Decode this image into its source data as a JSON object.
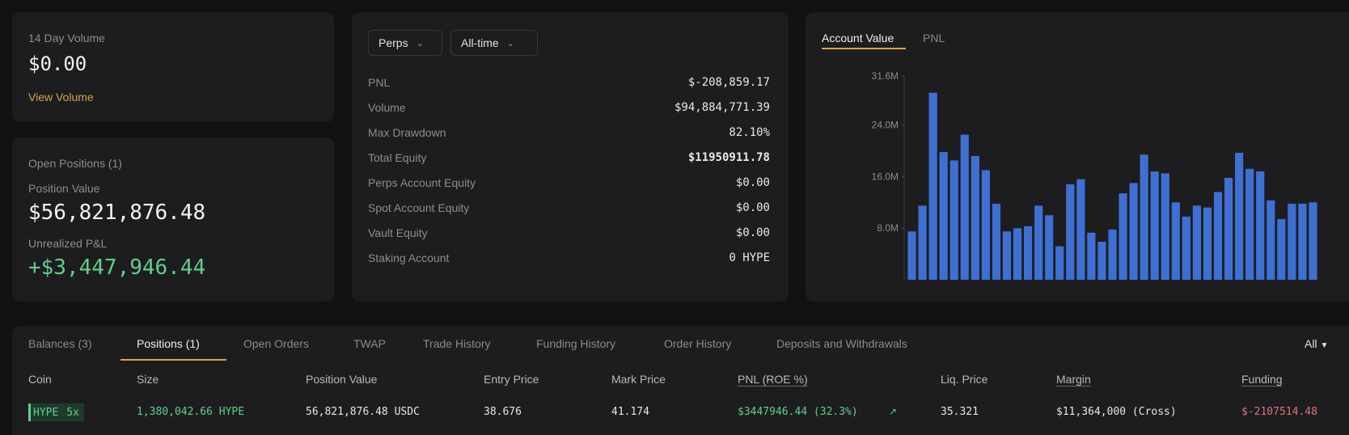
{
  "volume": {
    "label": "14 Day Volume",
    "value": "$0.00",
    "link": "View Volume"
  },
  "positions_summary": {
    "title": "Open Positions (1)",
    "value_label": "Position Value",
    "value": "$56,821,876.48",
    "upnl_label": "Unrealized P&L",
    "upnl": "+$3,447,946.44"
  },
  "stats": {
    "filter_market": "Perps",
    "filter_range": "All-time",
    "rows": [
      {
        "key": "PNL",
        "value": "$-208,859.17"
      },
      {
        "key": "Volume",
        "value": "$94,884,771.39"
      },
      {
        "key": "Max Drawdown",
        "value": "82.10%"
      },
      {
        "key": "Total Equity",
        "value": "$11950911.78"
      },
      {
        "key": "Perps Account Equity",
        "value": "$0.00"
      },
      {
        "key": "Spot Account Equity",
        "value": "$0.00"
      },
      {
        "key": "Vault Equity",
        "value": "$0.00"
      },
      {
        "key": "Staking Account",
        "value": "0 HYPE"
      }
    ]
  },
  "chart_tabs": {
    "active": "Account Value",
    "other": "PNL"
  },
  "chart_data": {
    "type": "bar",
    "title": "",
    "xlabel": "",
    "ylabel": "",
    "ylim": [
      0,
      31.6
    ],
    "yticks": [
      "8.0M",
      "16.0M",
      "24.0M",
      "31.6M"
    ],
    "ytick_values": [
      8,
      16,
      24,
      31.6
    ],
    "values": [
      7.5,
      11.5,
      29,
      19.8,
      18.5,
      22.5,
      19.2,
      17,
      11.8,
      7.5,
      8,
      8.3,
      11.5,
      10,
      5.2,
      14.8,
      15.6,
      7.3,
      5.9,
      7.8,
      13.4,
      15,
      19.4,
      16.8,
      16.5,
      12,
      9.8,
      11.5,
      11.2,
      13.6,
      15.8,
      19.7,
      17.2,
      16.8,
      12.3,
      9.4,
      11.8,
      11.8,
      12
    ],
    "color": "#3f6fd1",
    "grid": false
  },
  "table": {
    "tabs": [
      "Balances (3)",
      "Positions (1)",
      "Open Orders",
      "TWAP",
      "Trade History",
      "Funding History",
      "Order History",
      "Deposits and Withdrawals"
    ],
    "active_tab": "Positions (1)",
    "filter": "All",
    "headers": [
      "Coin",
      "Size",
      "Position Value",
      "Entry Price",
      "Mark Price",
      "PNL (ROE %)",
      "Liq. Price",
      "Margin",
      "Funding"
    ],
    "row": {
      "coin": "HYPE",
      "leverage": "5x",
      "size": "1,380,042.66 HYPE",
      "position_value": "56,821,876.48 USDC",
      "entry_price": "38.676",
      "mark_price": "41.174",
      "pnl": "$3447946.44 (32.3%)",
      "liq_price": "35.321",
      "margin": "$11,364,000 (Cross)",
      "funding": "$-2107514.48"
    }
  },
  "colors": {
    "bg": "#121213",
    "card": "#1d1d1f",
    "accent": "#d9a14a",
    "positive": "#5fd08a",
    "negative": "#e0707a",
    "bar": "#3f6fd1"
  }
}
